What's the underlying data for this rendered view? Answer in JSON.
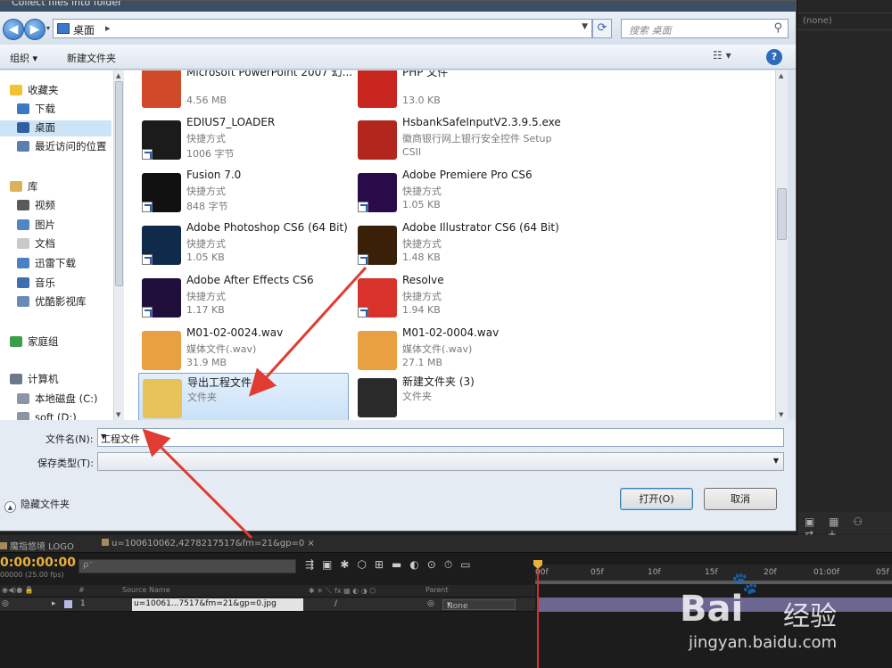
{
  "dialog": {
    "title": "Collect files into folder",
    "address": "桌面",
    "search_placeholder": "搜索 桌面",
    "toolbar": {
      "organize": "组织 ▾",
      "new_folder": "新建文件夹",
      "help": "?"
    },
    "sidebar": [
      {
        "label": "收藏夹",
        "icon": "star-icon",
        "color": "#f2c230"
      },
      {
        "label": "下载",
        "icon": "download-folder-icon",
        "color": "#3c78c8"
      },
      {
        "label": "桌面",
        "icon": "desktop-icon",
        "color": "#2f5fa3",
        "selected": true
      },
      {
        "label": "最近访问的位置",
        "icon": "recent-places-icon",
        "color": "#5a7fb0"
      },
      {
        "label": "库",
        "icon": "library-icon",
        "color": "#d9b25a"
      },
      {
        "label": "视频",
        "icon": "videos-icon",
        "color": "#5a5a5a"
      },
      {
        "label": "图片",
        "icon": "pictures-icon",
        "color": "#4f86c6"
      },
      {
        "label": "文档",
        "icon": "documents-icon",
        "color": "#c9c9c9"
      },
      {
        "label": "迅雷下载",
        "icon": "thunder-download-icon",
        "color": "#4a80c4"
      },
      {
        "label": "音乐",
        "icon": "music-icon",
        "color": "#3f6fb0"
      },
      {
        "label": "优酷影视库",
        "icon": "youku-library-icon",
        "color": "#6a8ab8"
      },
      {
        "label": "家庭组",
        "icon": "homegroup-icon",
        "color": "#3a9e4a"
      },
      {
        "label": "计算机",
        "icon": "computer-icon",
        "color": "#6a7a8c"
      },
      {
        "label": "本地磁盘 (C:)",
        "icon": "disk-c-icon",
        "color": "#8a96a6"
      },
      {
        "label": "soft (D:)",
        "icon": "disk-d-icon",
        "color": "#8a96a6"
      }
    ],
    "files": [
      {
        "name": "Microsoft PowerPoint 2007 幻...",
        "type": "",
        "size": "4.56 MB",
        "icon": "powerpoint-icon",
        "color": "#d04a2a"
      },
      {
        "name": "PHP 文件",
        "type": "",
        "size": "13.0 KB",
        "icon": "pdf-icon",
        "color": "#c8261e"
      },
      {
        "name": "EDIUS7_LOADER",
        "type": "快捷方式",
        "size": "1006 字节",
        "icon": "edius-icon",
        "color": "#1b1b1b"
      },
      {
        "name": "HsbankSafeInputV2.3.9.5.exe",
        "type": "徽商银行网上银行安全控件 Setup",
        "size": "CSII",
        "icon": "hsbank-icon",
        "color": "#b3261e"
      },
      {
        "name": "Fusion 7.0",
        "type": "快捷方式",
        "size": "848 字节",
        "icon": "fusion-icon",
        "color": "#111111"
      },
      {
        "name": "Adobe Premiere Pro CS6",
        "type": "快捷方式",
        "size": "1.05 KB",
        "icon": "premiere-icon",
        "color": "#2a0b4a"
      },
      {
        "name": "Adobe Photoshop CS6 (64 Bit)",
        "type": "快捷方式",
        "size": "1.05 KB",
        "icon": "photoshop-icon",
        "color": "#0f2a4a"
      },
      {
        "name": "Adobe Illustrator CS6 (64 Bit)",
        "type": "快捷方式",
        "size": "1.48 KB",
        "icon": "illustrator-icon",
        "color": "#3a2008"
      },
      {
        "name": "Adobe After Effects CS6",
        "type": "快捷方式",
        "size": "1.17 KB",
        "icon": "aftereffects-icon",
        "color": "#1f0f3a"
      },
      {
        "name": "Resolve",
        "type": "快捷方式",
        "size": "1.94 KB",
        "icon": "resolve-icon",
        "color": "#d8322a"
      },
      {
        "name": "M01-02-0024.wav",
        "type": "媒体文件(.wav)",
        "size": "31.9 MB",
        "icon": "wav-file-icon",
        "color": "#e8a040"
      },
      {
        "name": "M01-02-0004.wav",
        "type": "媒体文件(.wav)",
        "size": "27.1 MB",
        "icon": "wav-file-icon",
        "color": "#e8a040"
      },
      {
        "name": "导出工程文件",
        "type": "文件夹",
        "size": "",
        "icon": "folder-icon",
        "color": "#e8c35a",
        "selected": true
      },
      {
        "name": "新建文件夹 (3)",
        "type": "文件夹",
        "size": "",
        "icon": "folder-icon",
        "color": "#2a2a2a"
      }
    ],
    "filename_label": "文件名(N):",
    "filename_value": "工程文件",
    "filetype_label": "保存类型(T):",
    "hide_folders": "隐藏文件夹",
    "open_button": "打开(O)",
    "cancel_button": "取消"
  },
  "ae": {
    "top_right": "(none)",
    "tab1": "魔指悠境 LOGO",
    "tab2": "u=100610062,4278217517&fm=21&gp=0",
    "timecode": "0:00:00:00",
    "fps": "00000 (25.00 fps)",
    "search_placeholder": "ρ⁻",
    "ruler": [
      "00f",
      "05f",
      "10f",
      "15f",
      "20f",
      "01:00f",
      "05f"
    ],
    "header_source": "Source Name",
    "header_parent": "Parent",
    "header_hash": "#",
    "layer_num": "1",
    "layer_name": "u=10061...7517&fm=21&gp=0.jpg",
    "parent_value": "None"
  },
  "watermark": {
    "brand": "Bai",
    "cn": "经验",
    "paw": "🐾",
    "url": "jingyan.baidu.com"
  },
  "arrow_color": "#e03c31"
}
